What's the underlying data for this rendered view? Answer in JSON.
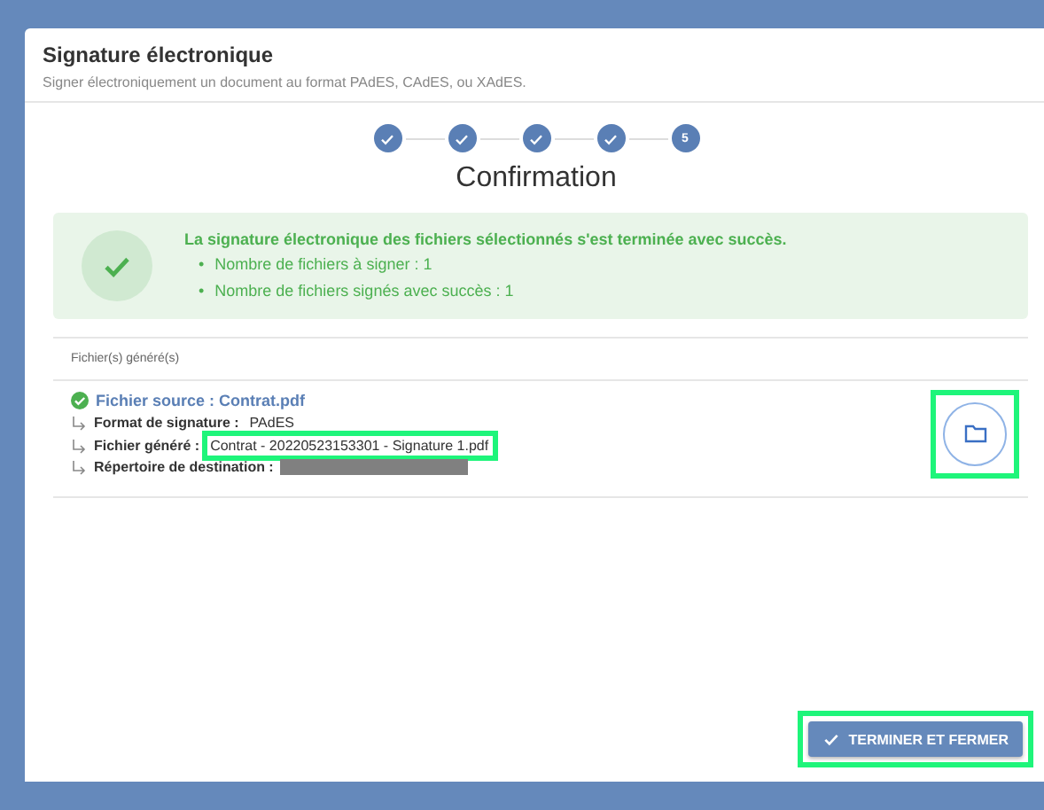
{
  "dialog": {
    "title": "Signature électronique",
    "subtitle": "Signer électroniquement un document au format PAdES, CAdES, ou XAdES."
  },
  "steps": [
    {
      "done": true
    },
    {
      "done": true
    },
    {
      "done": true
    },
    {
      "done": true
    },
    {
      "label": "5",
      "done": false
    }
  ],
  "step_title": "Confirmation",
  "alert": {
    "message": "La signature électronique des fichiers sélectionnés s'est terminée avec succès.",
    "items": [
      {
        "bullet": "•",
        "text": "Nombre de fichiers à signer : 1"
      },
      {
        "bullet": "•",
        "text": "Nombre de fichiers signés avec succès : 1"
      }
    ]
  },
  "section_title": "Fichier(s) généré(s)",
  "file": {
    "source": "Fichier source : Contrat.pdf",
    "details": [
      {
        "kind": "text",
        "label": "Format de signature :",
        "value": "PAdES",
        "highlighted": false
      },
      {
        "kind": "text",
        "label": "Fichier généré :",
        "value": "Contrat - 20220523153301 - Signature 1.pdf",
        "highlighted": true
      },
      {
        "kind": "redacted",
        "label": "Répertoire de destination :"
      }
    ],
    "folder_highlighted": true
  },
  "finish_button": {
    "label": "TERMINER ET FERMER",
    "highlighted": true
  }
}
